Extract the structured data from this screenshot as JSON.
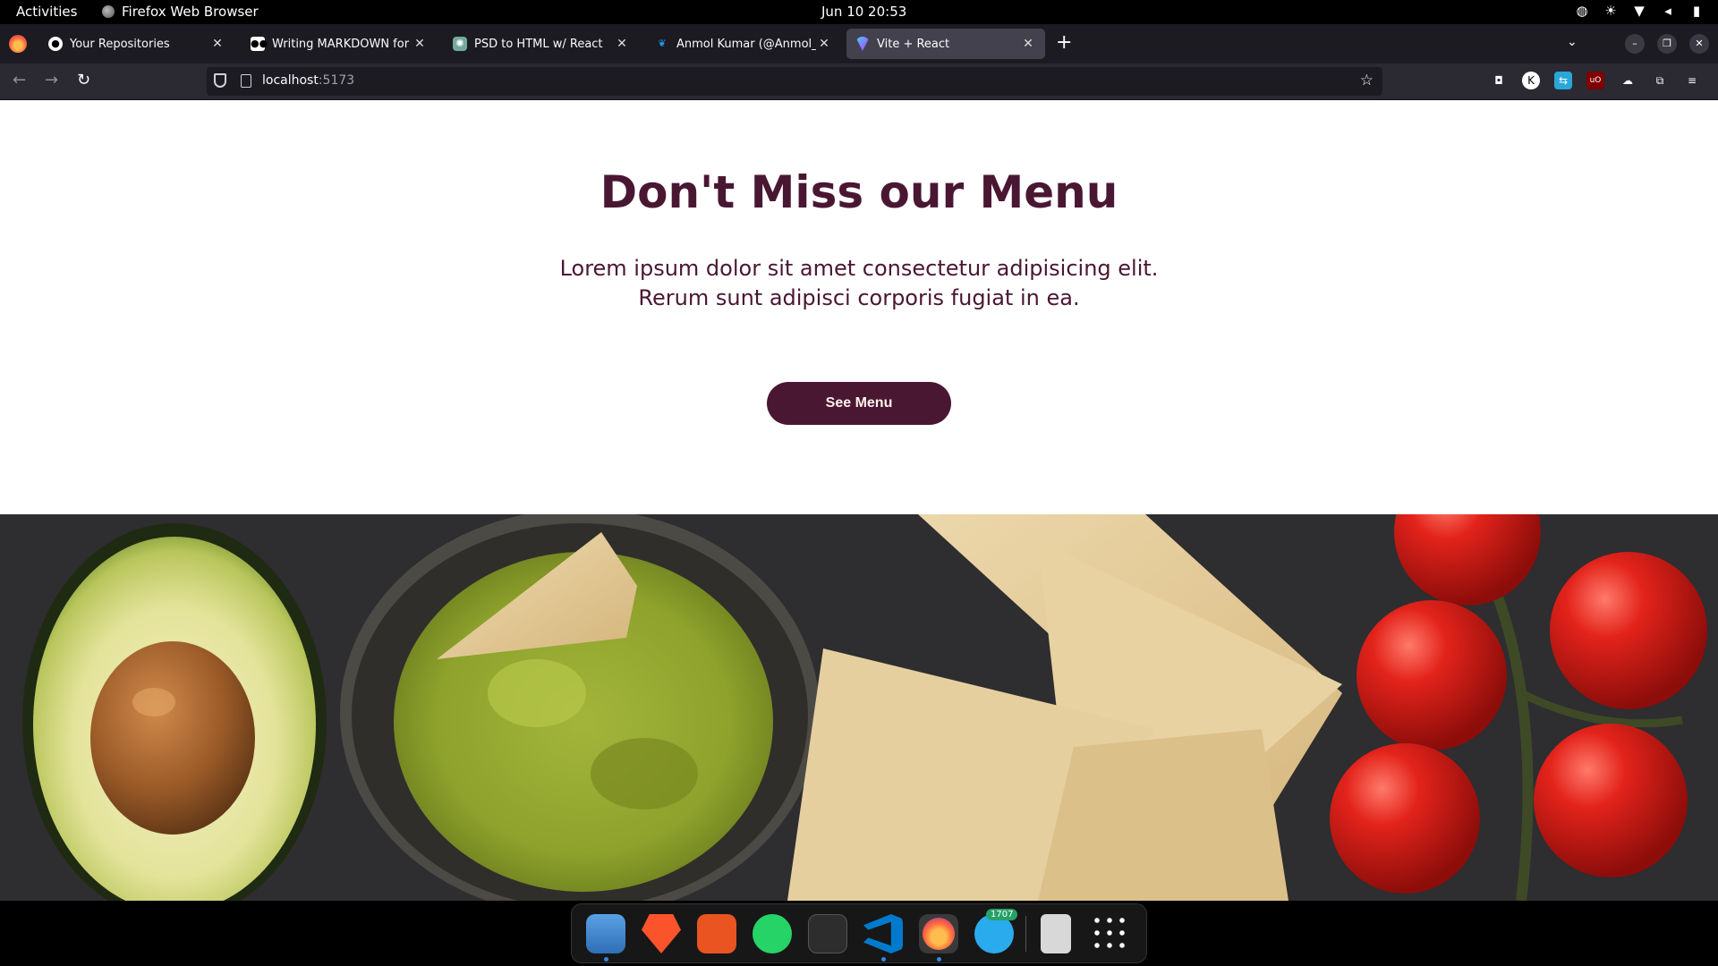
{
  "system": {
    "activities": "Activities",
    "app_name": "Firefox Web Browser",
    "clock": "Jun 10  20:53"
  },
  "browser": {
    "tabs": [
      {
        "label": "Your Repositories",
        "icon": "github-icon"
      },
      {
        "label": "Writing MARKDOWN for yo",
        "icon": "medium-icon"
      },
      {
        "label": "PSD to HTML w/ React",
        "icon": "chatgpt-icon"
      },
      {
        "label": "Anmol Kumar (@Anmol_kr",
        "icon": "twitter-icon"
      },
      {
        "label": "Vite + React",
        "icon": "vite-icon",
        "active": true
      }
    ],
    "url_host": "localhost",
    "url_port": ":5173"
  },
  "page": {
    "heading": "Don't Miss our Menu",
    "subtext_line1": "Lorem ipsum dolor sit amet consectetur adipisicing elit.",
    "subtext_line2": "Rerum sunt adipisci corporis fugiat in ea.",
    "button_label": "See Menu",
    "accent_color": "#4a1733",
    "image_description_icons": [
      "avocado",
      "guacamole-bowl",
      "tortilla-chips",
      "cherry-tomatoes"
    ]
  },
  "dock": {
    "apps": [
      "files-icon",
      "brave-icon",
      "app-store-icon",
      "whatsapp-icon",
      "terminal-icon",
      "vscode-icon",
      "firefox-icon",
      "telegram-icon",
      "trash-icon",
      "app-grid-icon"
    ],
    "telegram_badge": "1707"
  }
}
